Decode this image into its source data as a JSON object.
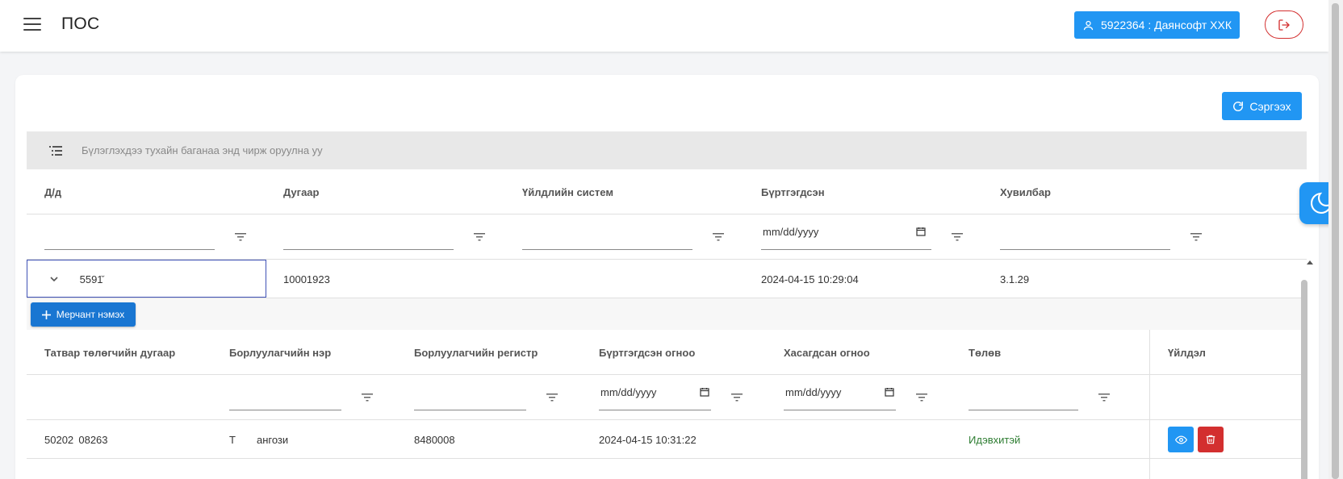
{
  "header": {
    "title": "ПОС",
    "user_label": "5922364 : Даянсофт ХХК"
  },
  "toolbar": {
    "refresh_label": "Сэргээх"
  },
  "group_panel": {
    "hint": "Бүлэглэхдээ тухайн баганаа энд чирж оруулна уу"
  },
  "main_table": {
    "columns": [
      "Д/д",
      "Дугаар",
      "Үйлдлийн систем",
      "Бүртгэгдсэн",
      "Хувилбар"
    ],
    "date_placeholder": "mm/dd/yyyy",
    "rows": [
      {
        "id": " 5591̆",
        "number": "10001923",
        "os": "",
        "registered": "2024-04-15 10:29:04",
        "version": "3.1.29"
      }
    ]
  },
  "detail": {
    "add_merchant_label": "Мерчант нэмэх",
    "columns": [
      "Татвар төлөгчийн дугаар",
      "Борлуулагчийн нэр",
      "Борлуулагчийн регистр",
      "Бүртгэгдсэн огноо",
      "Хасагдсан огноо",
      "Төлөв",
      "Үйлдэл"
    ],
    "date_placeholder": "mm/dd/yyyy",
    "rows": [
      {
        "tin": "50202  08263",
        "name": "Т          ангози",
        "register": "8480008",
        "registered": "2024-04-15 10:31:22",
        "removed": "",
        "status": "Идэвхитэй"
      }
    ]
  },
  "colors": {
    "primary": "#2196f3",
    "danger": "#d32f2f",
    "success": "#2e7d32",
    "focus": "#3f51b5"
  },
  "icons": {
    "menu": "hamburger-icon",
    "user": "user-icon",
    "logout": "logout-icon",
    "refresh": "refresh-icon",
    "group": "group-list-icon",
    "filter": "filter-icon",
    "calendar": "calendar-icon",
    "expand": "chevron-down-icon",
    "add": "plus-icon",
    "view": "eye-icon",
    "delete": "trash-icon",
    "theme": "moon-icon"
  }
}
